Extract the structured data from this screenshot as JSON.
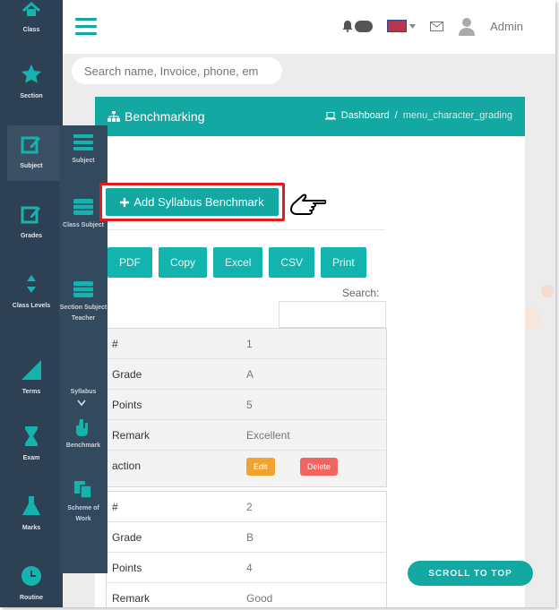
{
  "sidebar": {
    "items": [
      {
        "label": "Class",
        "icon": "class-icon"
      },
      {
        "label": "Section",
        "icon": "star-icon"
      },
      {
        "label": "Subject",
        "icon": "edit-icon"
      },
      {
        "label": "Grades",
        "icon": "edit-icon"
      },
      {
        "label": "Class Levels",
        "icon": "sort-icon"
      },
      {
        "label": "Terms",
        "icon": "signal-icon"
      },
      {
        "label": "Exam",
        "icon": "hourglass-icon"
      },
      {
        "label": "Marks",
        "icon": "flask-icon"
      },
      {
        "label": "Routine",
        "icon": "clock-icon"
      }
    ]
  },
  "subsidebar": {
    "items": [
      {
        "label": "Subject",
        "icon": "stack-icon"
      },
      {
        "label": "Class Subject",
        "icon": "stack-icon"
      },
      {
        "label": "Section Subject Teacher",
        "icon": "stack-icon"
      },
      {
        "label": "Syllabus",
        "icon": "chevron-down-icon"
      },
      {
        "label": "Benchmark",
        "icon": "hand-icon"
      },
      {
        "label": "Scheme of Work",
        "icon": "copy-icon"
      }
    ]
  },
  "header": {
    "admin": "Admin"
  },
  "search": {
    "placeholder": "Search name, Invoice, phone, em"
  },
  "panel": {
    "title": "Benchmarking",
    "breadcrumb_home": "Dashboard",
    "breadcrumb_sep": "/",
    "breadcrumb_current": "menu_character_grading"
  },
  "actions": {
    "add_label": "Add Syllabus Benchmark"
  },
  "export": {
    "buttons": [
      "PDF",
      "Copy",
      "Excel",
      "CSV",
      "Print"
    ]
  },
  "table": {
    "search_label": "Search:",
    "labels": {
      "num": "#",
      "grade": "Grade",
      "points": "Points",
      "remark": "Remark",
      "action": "action"
    },
    "rows": [
      {
        "num": "1",
        "grade": "A",
        "points": "5",
        "remark": "Excellent",
        "edit": "Edit",
        "delete": "Delete"
      },
      {
        "num": "2",
        "grade": "B",
        "points": "4",
        "remark": "Good"
      }
    ]
  },
  "scroll_top": "SCROLL TO TOP",
  "colors": {
    "accent": "#14a8a2",
    "sidebar": "#2e4154",
    "highlight": "#e21b1b",
    "edit": "#f0a331",
    "delete": "#f06462"
  }
}
